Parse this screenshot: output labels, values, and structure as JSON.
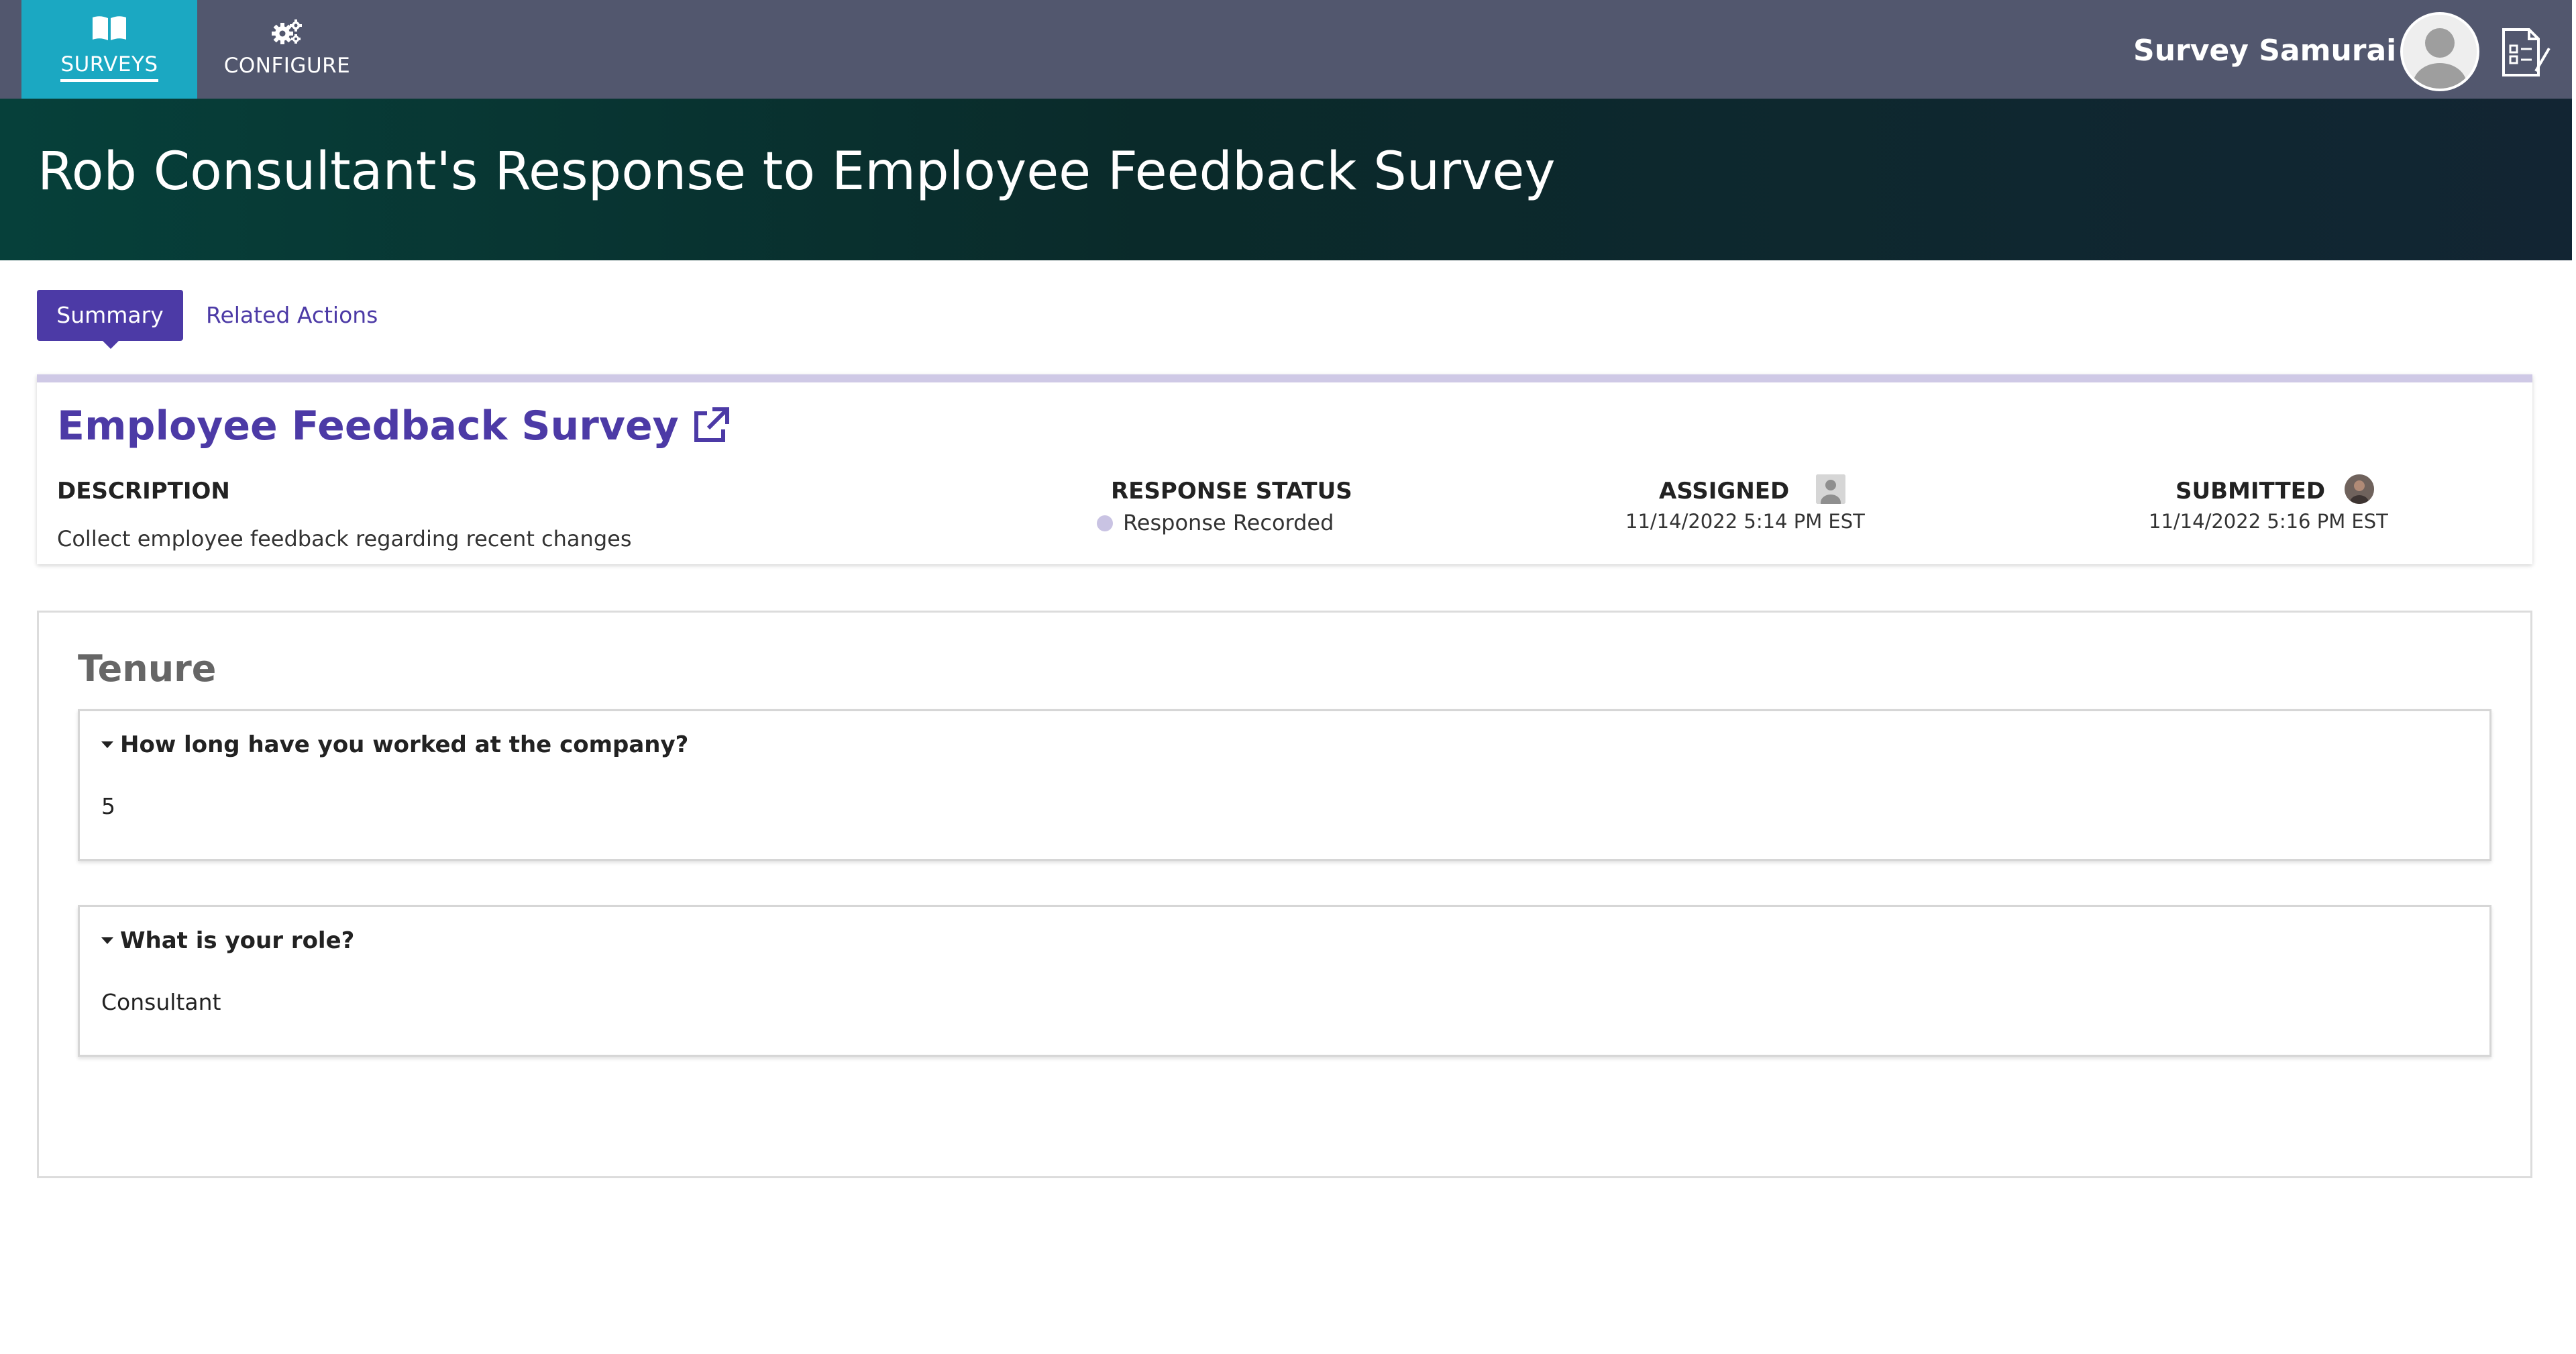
{
  "nav": {
    "items": [
      {
        "label": "SURVEYS",
        "icon": "book-icon",
        "active": true
      },
      {
        "label": "CONFIGURE",
        "icon": "gears-icon",
        "active": false
      }
    ],
    "user_name": "Survey Samurai"
  },
  "header": {
    "title": "Rob Consultant's Response to Employee Feedback Survey"
  },
  "tabs": [
    {
      "label": "Summary",
      "active": true
    },
    {
      "label": "Related Actions",
      "active": false
    }
  ],
  "summary": {
    "survey_name": "Employee Feedback Survey",
    "description_label": "DESCRIPTION",
    "description": "Collect employee feedback regarding recent changes",
    "status_label": "RESPONSE STATUS",
    "status": "Response Recorded",
    "assigned_label": "ASSIGNED",
    "assigned_date": "11/14/2022 5:14 PM  EST",
    "submitted_label": "SUBMITTED",
    "submitted_date": "11/14/2022 5:16 PM  EST"
  },
  "section": {
    "title": "Tenure",
    "questions": [
      {
        "question": "How long have you worked at the company?",
        "answer": "5"
      },
      {
        "question": "What is your role?",
        "answer": "Consultant"
      }
    ]
  },
  "colors": {
    "nav_bg": "#52576e",
    "nav_active": "#1ba8c2",
    "accent": "#4c3aa6",
    "status_dot": "#c9c3e3"
  }
}
